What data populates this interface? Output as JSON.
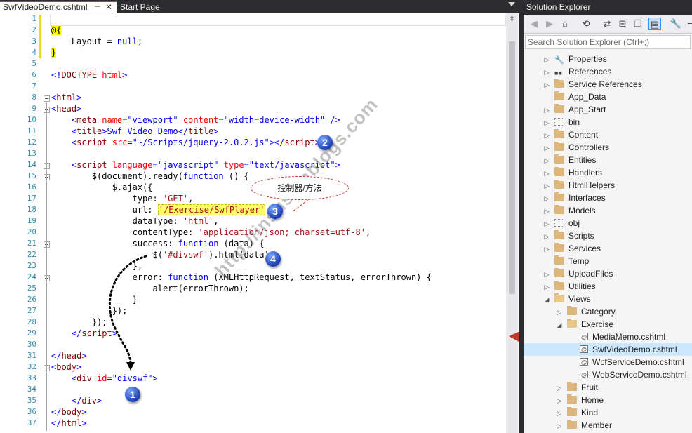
{
  "editor": {
    "tabs": [
      {
        "label": "SwfVideoDemo.cshtml",
        "active": true
      },
      {
        "label": "Start Page",
        "active": false
      }
    ],
    "pin_glyph": "⊣",
    "close_glyph": "✕",
    "split_glyph": "⇳",
    "line_numbers": [
      "1",
      "2",
      "3",
      "4",
      "5",
      "6",
      "7",
      "8",
      "9",
      "10",
      "11",
      "12",
      "13",
      "14",
      "15",
      "16",
      "17",
      "18",
      "19",
      "20",
      "21",
      "22",
      "23",
      "24",
      "25",
      "26",
      "27",
      "28",
      "29",
      "30",
      "31",
      "32",
      "33",
      "34",
      "35",
      "36",
      "37"
    ],
    "code": {
      "l2": "@{",
      "l3a": "    Layout = ",
      "l3b": "null",
      "l3c": ";",
      "l4": "}",
      "l6a": "<!",
      "l6b": "DOCTYPE",
      "l6c": " html",
      "l6d": ">",
      "l8a": "<",
      "l8b": "html",
      "l8c": ">",
      "l9b": "head",
      "l10a": "    <",
      "l10b": "meta",
      "l10c": " name",
      "l10d": "=\"viewport\"",
      "l10e": " content",
      "l10f": "=\"width=device-width\"",
      "l10g": " />",
      "l11b": "title",
      "l11c": ">Swf Video Demo</",
      "l11d": "title",
      "l12b": "script",
      "l12c": " src",
      "l12d": "=\"~/Scripts/jquery-2.0.2.js\"",
      "l12e": "></",
      "l12f": "script",
      "l14b": "script",
      "l14c": " language",
      "l14d": "=\"javascript\"",
      "l14e": " type",
      "l14f": "=\"text/javascript\"",
      "l15a": "        $(document).ready(",
      "l15b": "function",
      "l15c": " () {",
      "l16": "            $.ajax({",
      "l17a": "                type: ",
      "l17b": "'GET'",
      "l17c": ",",
      "l18a": "                url: ",
      "l18b": "'/Exercise/SwfPlayer'",
      "l18c": ",",
      "l19a": "                dataType: ",
      "l19b": "'html'",
      "l19c": ",",
      "l20a": "                contentType: ",
      "l20b": "'application/json; charset=utf-8'",
      "l20c": ",",
      "l21a": "                success: ",
      "l21b": "function",
      "l21c": " (data) {",
      "l22a": "                    $(",
      "l22b": "'#divswf'",
      "l22c": ").html(data)",
      "l23": "                },",
      "l24a": "                error: ",
      "l24b": "function",
      "l24c": " (XMLHttpRequest, textStatus, errorThrown) {",
      "l25": "                    alert(errorThrown);",
      "l26": "                }",
      "l27": "            });",
      "l28": "        });",
      "l29a": "    </",
      "l29b": "script",
      "l29c": ">",
      "l31a": "</",
      "l31b": "head",
      "l32b": "body",
      "l33b": "div",
      "l33c": " id",
      "l33d": "=\"divswf\"",
      "l35b": "div",
      "l36b": "body",
      "l37b": "html"
    }
  },
  "annotations": {
    "bubble_text": "控制器/方法",
    "badges": [
      "1",
      "2",
      "3",
      "4"
    ],
    "watermark": "http://insus.cnblogs.com"
  },
  "solution_explorer": {
    "title": "Solution Explorer",
    "search_placeholder": "Search Solution Explorer (Ctrl+;)",
    "toolbar": [
      "back-icon",
      "forward-icon",
      "home-icon",
      "sync-icon",
      "refresh-icon",
      "collapse-icon",
      "copy-icon",
      "show-all-files-icon",
      "properties-icon",
      "minus-icon"
    ],
    "tree": [
      {
        "label": "Properties",
        "depth": 0,
        "arrow": "collapsed",
        "icon": "wrench"
      },
      {
        "label": "References",
        "depth": 0,
        "arrow": "collapsed",
        "icon": "refs"
      },
      {
        "label": "Service References",
        "depth": 0,
        "arrow": "collapsed",
        "icon": "folder"
      },
      {
        "label": "App_Data",
        "depth": 0,
        "arrow": "none",
        "icon": "folder"
      },
      {
        "label": "App_Start",
        "depth": 0,
        "arrow": "collapsed",
        "icon": "folder"
      },
      {
        "label": "bin",
        "depth": 0,
        "arrow": "collapsed",
        "icon": "dotfolder"
      },
      {
        "label": "Content",
        "depth": 0,
        "arrow": "collapsed",
        "icon": "folder"
      },
      {
        "label": "Controllers",
        "depth": 0,
        "arrow": "collapsed",
        "icon": "folder"
      },
      {
        "label": "Entities",
        "depth": 0,
        "arrow": "collapsed",
        "icon": "folder"
      },
      {
        "label": "Handlers",
        "depth": 0,
        "arrow": "collapsed",
        "icon": "folder"
      },
      {
        "label": "HtmlHelpers",
        "depth": 0,
        "arrow": "collapsed",
        "icon": "folder"
      },
      {
        "label": "Interfaces",
        "depth": 0,
        "arrow": "collapsed",
        "icon": "folder"
      },
      {
        "label": "Models",
        "depth": 0,
        "arrow": "collapsed",
        "icon": "folder"
      },
      {
        "label": "obj",
        "depth": 0,
        "arrow": "collapsed",
        "icon": "dotfolder"
      },
      {
        "label": "Scripts",
        "depth": 0,
        "arrow": "collapsed",
        "icon": "folder"
      },
      {
        "label": "Services",
        "depth": 0,
        "arrow": "collapsed",
        "icon": "folder"
      },
      {
        "label": "Temp",
        "depth": 0,
        "arrow": "none",
        "icon": "folder"
      },
      {
        "label": "UploadFiles",
        "depth": 0,
        "arrow": "collapsed",
        "icon": "folder"
      },
      {
        "label": "Utilities",
        "depth": 0,
        "arrow": "collapsed",
        "icon": "folder"
      },
      {
        "label": "Views",
        "depth": 0,
        "arrow": "expanded",
        "icon": "folder-open"
      },
      {
        "label": "Category",
        "depth": 1,
        "arrow": "collapsed",
        "icon": "folder"
      },
      {
        "label": "Exercise",
        "depth": 1,
        "arrow": "expanded",
        "icon": "folder-open"
      },
      {
        "label": "MediaMemo.cshtml",
        "depth": 2,
        "arrow": "none",
        "icon": "file"
      },
      {
        "label": "SwfVideoDemo.cshtml",
        "depth": 2,
        "arrow": "none",
        "icon": "file",
        "selected": true
      },
      {
        "label": "WcfServiceDemo.cshtml",
        "depth": 2,
        "arrow": "none",
        "icon": "file"
      },
      {
        "label": "WebServiceDemo.cshtml",
        "depth": 2,
        "arrow": "none",
        "icon": "file"
      },
      {
        "label": "Fruit",
        "depth": 1,
        "arrow": "collapsed",
        "icon": "folder"
      },
      {
        "label": "Home",
        "depth": 1,
        "arrow": "collapsed",
        "icon": "folder"
      },
      {
        "label": "Kind",
        "depth": 1,
        "arrow": "collapsed",
        "icon": "folder"
      },
      {
        "label": "Member",
        "depth": 1,
        "arrow": "collapsed",
        "icon": "folder"
      }
    ]
  },
  "colors": {
    "accent": "#007acc",
    "annotation_red": "#c0392b",
    "badge_blue": "#1b3fb0",
    "highlight_yellow": "#ffff00"
  }
}
